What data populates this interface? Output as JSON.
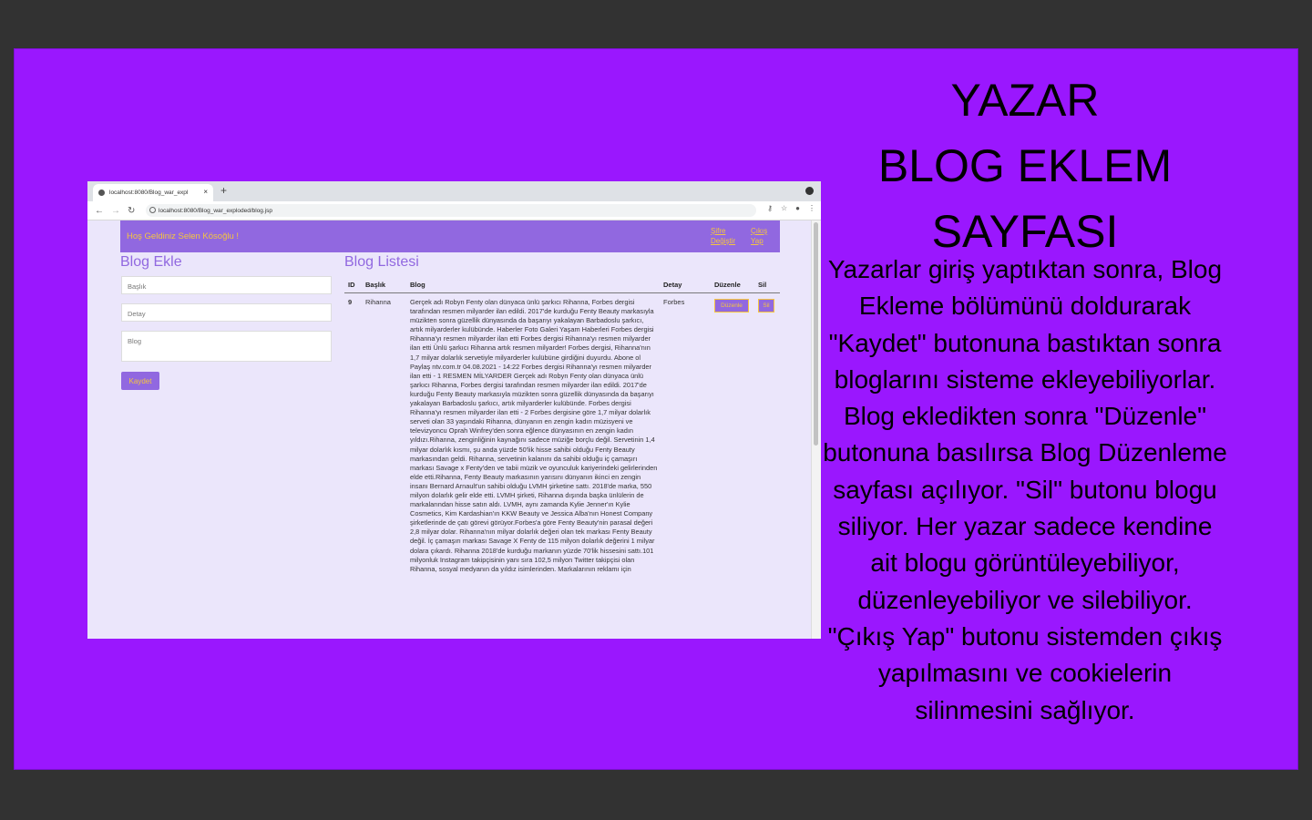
{
  "slide": {
    "title_lines": [
      "YAZAR",
      "BLOG EKLEM",
      "SAYFASI"
    ],
    "description": "Yazarlar giriş yaptıktan sonra, Blog Ekleme bölümünü doldurarak \"Kaydet\" butonuna bastıktan sonra bloglarını sisteme ekleyebiliyorlar. Blog ekledikten sonra \"Düzenle\" butonuna basılırsa Blog Düzenleme sayfası açılıyor. \"Sil\" butonu blogu siliyor. Her yazar sadece kendine ait blogu görüntüleyebiliyor, düzenleyebiliyor ve silebiliyor. \"Çıkış Yap\" butonu sistemden çıkış yapılmasını ve cookielerin silinmesini sağlıyor."
  },
  "browser": {
    "tab_title": "localhost:8080/Blog_war_expl",
    "url": "localhost:8080/Blog_war_exploded/blog.jsp",
    "icons": [
      "back-icon",
      "forward-icon",
      "reload-icon",
      "info-icon",
      "key-icon",
      "star-icon",
      "profile-icon",
      "menu-icon",
      "record-icon"
    ]
  },
  "app": {
    "welcome": "Hoş Geldiniz Selen Kösoğlu !",
    "nav": {
      "sifre_line1": "Şifre",
      "sifre_line2": "Değiştir",
      "cikis_line1": "Çıkış",
      "cikis_line2": "Yap"
    },
    "form": {
      "heading": "Blog Ekle",
      "baslik_placeholder": "Başlık",
      "detay_placeholder": "Detay",
      "blog_placeholder": "Blog",
      "submit_label": "Kaydet"
    },
    "list": {
      "heading": "Blog Listesi",
      "columns": [
        "ID",
        "Başlık",
        "Blog",
        "Detay",
        "Düzenle",
        "Sil"
      ],
      "rows": [
        {
          "id": "9",
          "baslik": "Rihanna",
          "blog": "Gerçek adı Robyn Fenty olan dünyaca ünlü şarkıcı Rihanna, Forbes dergisi tarafından resmen milyarder ilan edildi. 2017'de kurduğu Fenty Beauty markasıyla müzikten sonra güzellik dünyasında da başarıyı yakalayan Barbadoslu şarkıcı, artık milyarderler kulübünde. Haberler Foto Galeri Yaşam Haberleri Forbes dergisi Rihanna'yı resmen milyarder ilan etti Forbes dergisi Rihanna'yı resmen milyarder ilan etti Ünlü şarkıcı Rihanna artık resmen milyarder! Forbes dergisi, Rihanna'nın 1,7 milyar dolarlık servetiyle milyarderler kulübüne girdiğini duyurdu. Abone ol Paylaş ntv.com.tr 04.08.2021 - 14:22 Forbes dergisi Rihanna'yı resmen milyarder ilan etti - 1 RESMEN MİLYARDER Gerçek adı Robyn Fenty olan dünyaca ünlü şarkıcı Rihanna, Forbes dergisi tarafından resmen milyarder ilan edildi. 2017'de kurduğu Fenty Beauty markasıyla müzikten sonra güzellik dünyasında da başarıyı yakalayan Barbadoslu şarkıcı, artık milyarderler kulübünde. Forbes dergisi Rihanna'yı resmen milyarder ilan etti - 2 Forbes dergisine göre 1,7 milyar dolarlık serveti olan 33 yaşındaki Rihanna, dünyanın en zengin kadın müzisyeni ve televizyoncu Oprah Winfrey'den sonra eğlence dünyasının en zengin kadın yıldızı.Rihanna, zenginliğinin kaynağını sadece müziğe borçlu değil. Servetinin 1,4 milyar dolarlık kısmı, şu anda yüzde 50'lik hisse sahibi olduğu Fenty Beauty markasından geldi. Rihanna, servetinin kalanını da sahibi olduğu iç çamaşırı markası Savage x Fenty'den ve tabii müzik ve oyunculuk kariyerindeki gelirlerinden elde etti.Rihanna, Fenty Beauty markasının yarısını dünyanın ikinci en zengin insanı Bernard Arnault'un sahibi olduğu LVMH şirketine sattı. 2018'de marka, 550 milyon dolarlık gelir elde etti. LVMH şirketi, Rihanna dışında başka ünlülerin de markalarından hisse satın aldı. LVMH, aynı zamanda Kylie Jenner'ın Kylie Cosmetics, Kim Kardashian'ın KKW Beauty ve Jessica Alba'nın Honest Company şirketlerinde de çatı görevi görüyor.Forbes'a göre Fenty Beauty'nin parasal değeri 2,8 milyar dolar. Rihanna'nın milyar dolarlık değeri olan tek markası Fenty Beauty değil. İç çamaşırı markası Savage X Fenty de 115 milyon dolarlık değerini 1 milyar dolara çıkardı. Rihanna 2018'de kurduğu markanın yüzde 70'lik hissesini sattı.101 milyonluk Instagram takipçisinin yanı sıra 102,5 milyon Twitter takipçisi olan Rihanna, sosyal medyanın da yıldız isimlerinden. Markalarının reklamı için",
          "detay": "Forbes",
          "duzenle_label": "Düzenle",
          "sil_label": "Sil"
        }
      ]
    }
  }
}
